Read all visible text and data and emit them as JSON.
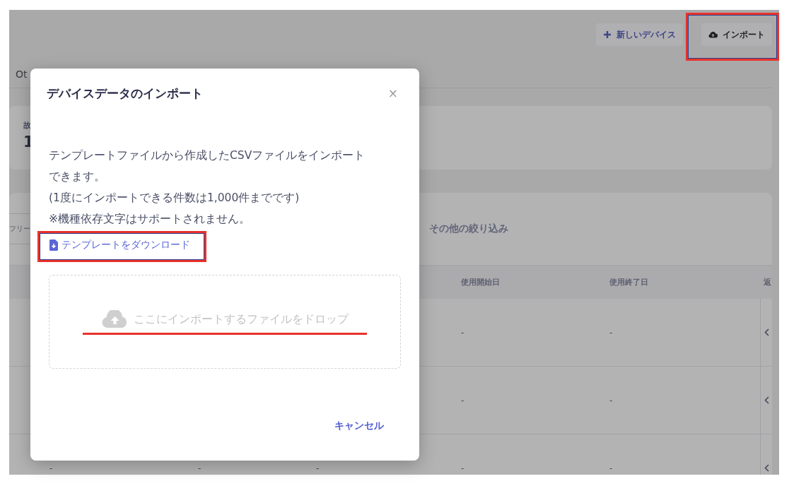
{
  "header": {
    "buttons": [
      {
        "label": "新しいデバイス",
        "kind": "add",
        "highlighted": false
      },
      {
        "label": "インポート",
        "kind": "import",
        "highlighted": true
      }
    ]
  },
  "tabs": [
    {
      "label": "Ot"
    }
  ],
  "summary_card": {
    "label": "故",
    "value": "1"
  },
  "filters": {
    "search_placeholder": "フリー",
    "more_filters": "その他の絞り込み"
  },
  "table": {
    "columns": [
      "使用開始日",
      "使用終了日",
      "返"
    ],
    "rows": [
      {
        "cells": [
          "-",
          "-"
        ]
      },
      {
        "cells": [
          "-",
          "-"
        ]
      },
      {
        "cells": [
          "-",
          "-"
        ],
        "cells_below_dialog": [
          "-",
          "-",
          "-"
        ]
      }
    ]
  },
  "dialog": {
    "title": "デバイスデータのインポート",
    "close": "×",
    "paragraphs": [
      "テンプレートファイルから作成したCSVファイルをインポートできます。",
      "(1度にインポートできる件数は1,000件までです)",
      "※機種依存文字はサポートされません。"
    ],
    "download_link": {
      "label": "テンプレートをダウンロード",
      "highlighted": true
    },
    "dropzone": {
      "placeholder": "ここにインポートするファイルをドロップ",
      "underlined": true
    },
    "cancel": "キャンセル"
  }
}
